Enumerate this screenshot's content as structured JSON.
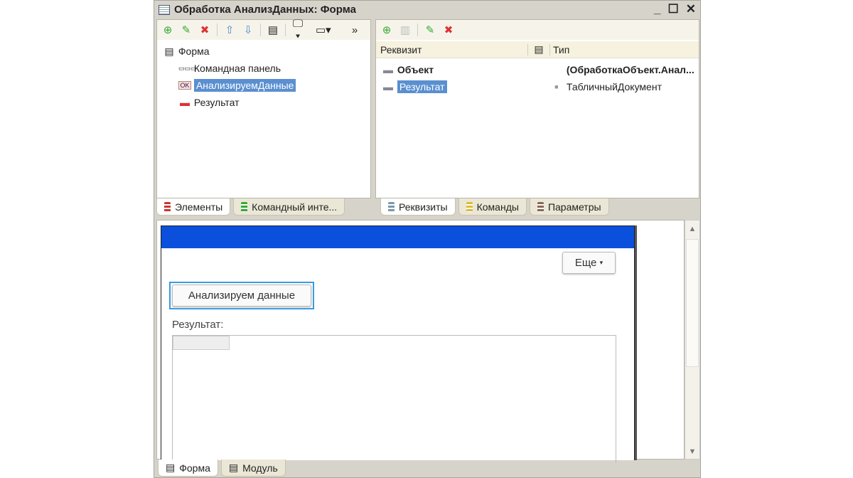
{
  "window": {
    "title": "Обработка АнализДанных: Форма",
    "minimize": "_",
    "maximize": "☐",
    "close": "✕"
  },
  "elements_tree": {
    "items": [
      {
        "label": "Форма",
        "icon": "form-icon"
      },
      {
        "label": "Командная панель",
        "icon": "command-bar-icon"
      },
      {
        "label": "АнализируемДанные",
        "icon": "ok-button-icon",
        "selected": true
      },
      {
        "label": "Результат",
        "icon": "field-icon"
      }
    ]
  },
  "left_tabs": [
    "Элементы",
    "Командный инте..."
  ],
  "attributes": {
    "headers": {
      "attr": "Реквизит",
      "type": "Тип"
    },
    "rows": [
      {
        "name": "Объект",
        "type": "(ОбработкаОбъект.Анал...",
        "bold": true
      },
      {
        "name": "Результат",
        "type": "ТабличныйДокумент",
        "selected": true
      }
    ]
  },
  "right_tabs": [
    "Реквизиты",
    "Команды",
    "Параметры"
  ],
  "preview": {
    "more_label": "Еще",
    "button_label": "Анализируем данные",
    "result_label": "Результат:",
    "header_color": "#0a50dc"
  },
  "bottom_tabs": [
    "Форма",
    "Модуль"
  ]
}
